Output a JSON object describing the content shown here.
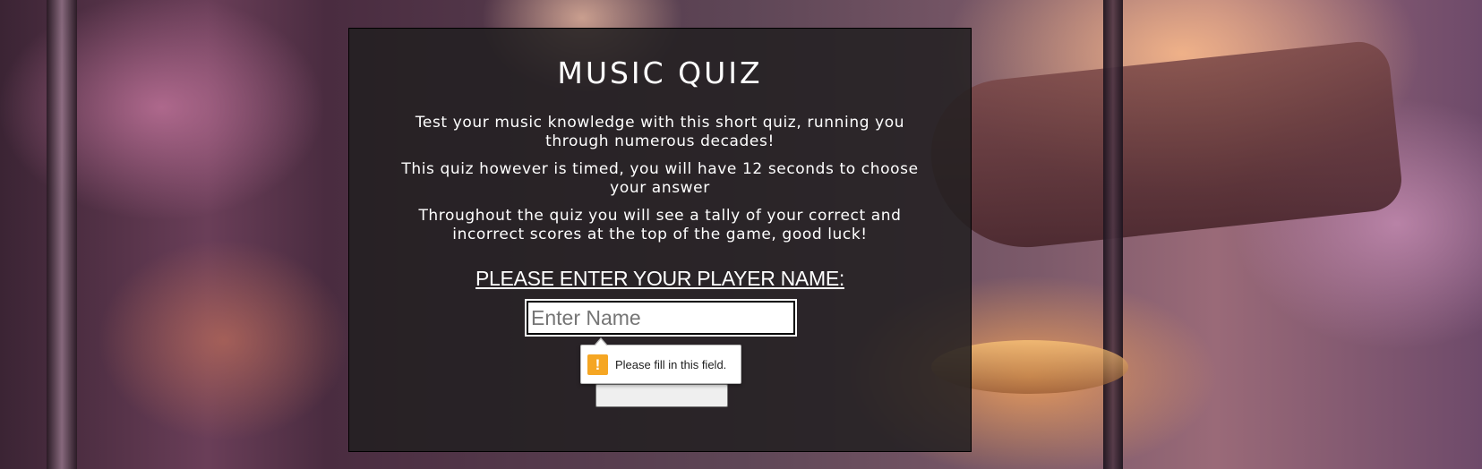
{
  "quiz": {
    "title": "MUSIC QUIZ",
    "intro": [
      "Test your music knowledge with this short quiz, running you through numerous decades!",
      "This quiz however is timed, you will have 12 seconds to choose your answer",
      "Throughout the quiz you will see a tally of your correct and incorrect scores at the top of the game, good luck!"
    ],
    "name_prompt": "PLEASE ENTER YOUR PLAYER NAME:",
    "name_input": {
      "value": "",
      "placeholder": "Enter Name"
    },
    "validation_message": "Please fill in this field.",
    "warning_icon": "exclamation-icon"
  },
  "colors": {
    "panel_bg": "#222021",
    "text": "#ffffff",
    "warning": "#f5a623"
  }
}
